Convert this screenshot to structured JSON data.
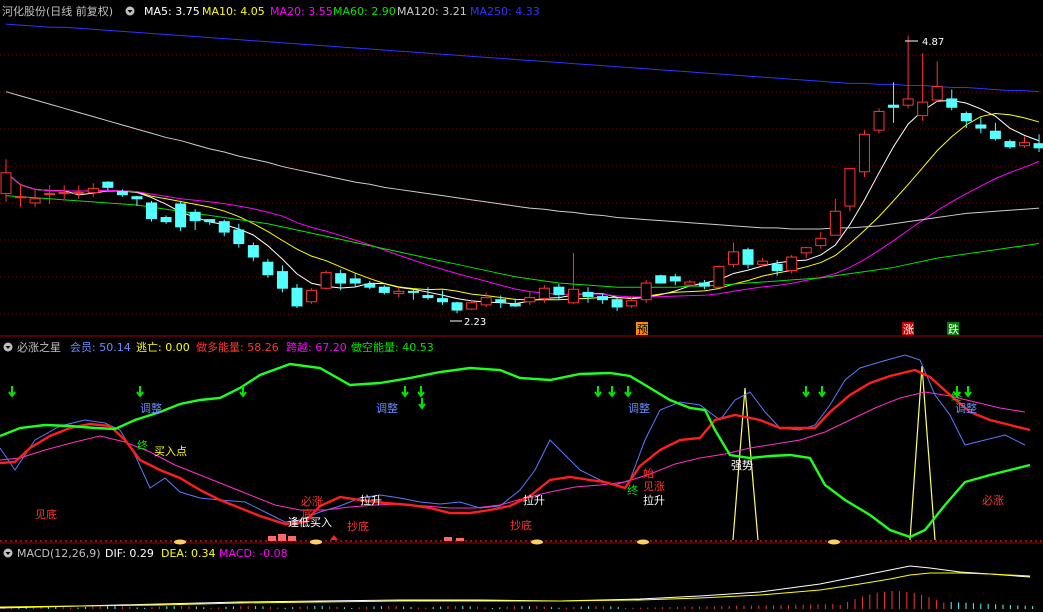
{
  "colors": {
    "up": "#ff3232",
    "down": "#54ffff",
    "ma5": "#ffffff",
    "ma10": "#ffff00",
    "ma20": "#ff00ff",
    "ma60": "#00e600",
    "ma120": "#cccccc",
    "ma250": "#3232ff",
    "grid": "#800000",
    "text": "#c0c0c0"
  },
  "main": {
    "header": {
      "title": "河化股份(日线 前复权)",
      "items": [
        {
          "label": "MA5: 3.75",
          "color": "#ffffff"
        },
        {
          "label": "MA10: 4.05",
          "color": "#ffff00"
        },
        {
          "label": "MA20: 3.55",
          "color": "#ff00ff"
        },
        {
          "label": "MA60: 2.90",
          "color": "#00e600"
        },
        {
          "label": "MA120: 3.21",
          "color": "#cccccc"
        },
        {
          "label": "MA250: 4.33",
          "color": "#3232ff"
        }
      ]
    },
    "high_label": "4.87",
    "low_label": "2.23",
    "markers": [
      {
        "text": "预",
        "bg": "#ff8c00"
      },
      {
        "text": "涨",
        "bg": "#cc0000"
      },
      {
        "text": "跌",
        "bg": "#008000"
      }
    ]
  },
  "ind1": {
    "header": {
      "title": "必涨之星",
      "items": [
        {
          "label": "会员: 50.14",
          "color": "#6a8cff"
        },
        {
          "label": "逃亡: 0.00",
          "color": "#ffff00"
        },
        {
          "label": "做多能量: 58.26",
          "color": "#ff3232"
        },
        {
          "label": "跨越: 67.20",
          "color": "#ff00ff"
        },
        {
          "label": "做空能量: 40.53",
          "color": "#00e600"
        }
      ]
    },
    "labels": [
      {
        "text": "调整",
        "color": "#6a8cff"
      },
      {
        "text": "调整",
        "color": "#6a8cff"
      },
      {
        "text": "调整",
        "color": "#6a8cff"
      },
      {
        "text": "调整",
        "color": "#6a8cff"
      },
      {
        "text": "见底",
        "color": "#ff3232"
      },
      {
        "text": "必涨",
        "color": "#ff3232"
      },
      {
        "text": "底",
        "color": "#ff3232"
      },
      {
        "text": "逢低买入",
        "color": "#ffffff"
      },
      {
        "text": "抄底",
        "color": "#ff3232"
      },
      {
        "text": "拉升",
        "color": "#ffffff"
      },
      {
        "text": "拉升",
        "color": "#ffffff"
      },
      {
        "text": "抄底",
        "color": "#ff3232"
      },
      {
        "text": "始",
        "color": "#ff3232"
      },
      {
        "text": "见涨",
        "color": "#ff3232"
      },
      {
        "text": "拉升",
        "color": "#ffffff"
      },
      {
        "text": "强势",
        "color": "#ffffff"
      },
      {
        "text": "必涨",
        "color": "#ff3232"
      },
      {
        "text": "买入点",
        "color": "#ffff00"
      },
      {
        "text": "终",
        "color": "#00e600"
      },
      {
        "text": "终",
        "color": "#00e600"
      },
      {
        "text": "终",
        "color": "#00e600"
      }
    ]
  },
  "ind2": {
    "header": {
      "title": "MACD(12,26,9)",
      "items": [
        {
          "label": "DIF: 0.29",
          "color": "#ffffff"
        },
        {
          "label": "DEA: 0.34",
          "color": "#ffff00"
        },
        {
          "label": "MACD: -0.08",
          "color": "#ff00ff"
        }
      ]
    }
  },
  "chart_data": {
    "type": "candlestick",
    "price_range": [
      2.0,
      5.0
    ],
    "candles": [
      [
        3.35,
        3.55,
        3.68,
        3.27
      ],
      [
        3.31,
        3.32,
        3.44,
        3.22
      ],
      [
        3.26,
        3.3,
        3.39,
        3.22
      ],
      [
        3.34,
        3.35,
        3.43,
        3.25
      ],
      [
        3.35,
        3.36,
        3.43,
        3.3
      ],
      [
        3.35,
        3.36,
        3.43,
        3.3
      ],
      [
        3.36,
        3.4,
        3.45,
        3.32
      ],
      [
        3.46,
        3.41,
        3.47,
        3.38
      ],
      [
        3.37,
        3.34,
        3.39,
        3.32
      ],
      [
        3.32,
        3.3,
        3.33,
        3.23
      ],
      [
        3.26,
        3.11,
        3.28,
        3.08
      ],
      [
        3.12,
        3.08,
        3.14,
        3.06
      ],
      [
        3.25,
        3.03,
        3.28,
        2.99
      ],
      [
        3.17,
        3.09,
        3.2,
        3.0
      ],
      [
        3.1,
        3.08,
        3.1,
        3.05
      ],
      [
        3.08,
        2.98,
        3.1,
        2.94
      ],
      [
        3.0,
        2.87,
        3.06,
        2.83
      ],
      [
        2.85,
        2.74,
        2.88,
        2.7
      ],
      [
        2.69,
        2.57,
        2.72,
        2.54
      ],
      [
        2.6,
        2.44,
        2.66,
        2.4
      ],
      [
        2.44,
        2.27,
        2.48,
        2.25
      ],
      [
        2.31,
        2.42,
        2.44,
        2.29
      ],
      [
        2.44,
        2.59,
        2.61,
        2.43
      ],
      [
        2.58,
        2.49,
        2.62,
        2.42
      ],
      [
        2.53,
        2.49,
        2.58,
        2.45
      ],
      [
        2.48,
        2.45,
        2.51,
        2.43
      ],
      [
        2.45,
        2.4,
        2.47,
        2.38
      ],
      [
        2.39,
        2.41,
        2.45,
        2.35
      ],
      [
        2.41,
        2.4,
        2.44,
        2.33
      ],
      [
        2.37,
        2.35,
        2.45,
        2.33
      ],
      [
        2.34,
        2.31,
        2.42,
        2.28
      ],
      [
        2.3,
        2.23,
        2.31,
        2.2
      ],
      [
        2.24,
        2.3,
        2.33,
        2.23
      ],
      [
        2.28,
        2.35,
        2.4,
        2.26
      ],
      [
        2.33,
        2.31,
        2.37,
        2.25
      ],
      [
        2.29,
        2.27,
        2.34,
        2.26
      ],
      [
        2.31,
        2.35,
        2.4,
        2.28
      ],
      [
        2.34,
        2.44,
        2.47,
        2.3
      ],
      [
        2.45,
        2.38,
        2.48,
        2.33
      ],
      [
        2.3,
        2.43,
        2.78,
        2.29
      ],
      [
        2.4,
        2.36,
        2.45,
        2.3
      ],
      [
        2.36,
        2.33,
        2.39,
        2.29
      ],
      [
        2.33,
        2.26,
        2.35,
        2.22
      ],
      [
        2.27,
        2.32,
        2.35,
        2.25
      ],
      [
        2.33,
        2.49,
        2.52,
        2.3
      ],
      [
        2.56,
        2.49,
        2.57,
        2.49
      ],
      [
        2.55,
        2.51,
        2.58,
        2.47
      ],
      [
        2.47,
        2.5,
        2.52,
        2.45
      ],
      [
        2.49,
        2.46,
        2.52,
        2.43
      ],
      [
        2.45,
        2.65,
        2.66,
        2.44
      ],
      [
        2.67,
        2.79,
        2.88,
        2.64
      ],
      [
        2.81,
        2.67,
        2.83,
        2.63
      ],
      [
        2.67,
        2.7,
        2.73,
        2.65
      ],
      [
        2.67,
        2.61,
        2.71,
        2.56
      ],
      [
        2.61,
        2.74,
        2.76,
        2.58
      ],
      [
        2.78,
        2.83,
        2.84,
        2.73
      ],
      [
        2.85,
        2.92,
        2.98,
        2.82
      ],
      [
        2.95,
        3.18,
        3.3,
        2.95
      ],
      [
        3.23,
        3.59,
        3.59,
        3.18
      ],
      [
        3.56,
        3.92,
        3.96,
        3.51
      ],
      [
        3.96,
        4.14,
        4.17,
        3.93
      ],
      [
        4.2,
        4.18,
        4.42,
        4.03
      ],
      [
        4.2,
        4.26,
        4.87,
        4.17
      ],
      [
        4.1,
        4.23,
        4.7,
        4.05
      ],
      [
        4.25,
        4.38,
        4.62,
        4.23
      ],
      [
        4.26,
        4.18,
        4.35,
        4.15
      ],
      [
        4.12,
        4.05,
        4.14,
        3.98
      ],
      [
        4.01,
        3.98,
        4.08,
        3.93
      ],
      [
        3.95,
        3.88,
        4.03,
        3.86
      ],
      [
        3.85,
        3.8,
        3.87,
        3.78
      ],
      [
        3.81,
        3.84,
        3.9,
        3.79
      ],
      [
        3.83,
        3.79,
        3.92,
        3.75
      ]
    ]
  }
}
